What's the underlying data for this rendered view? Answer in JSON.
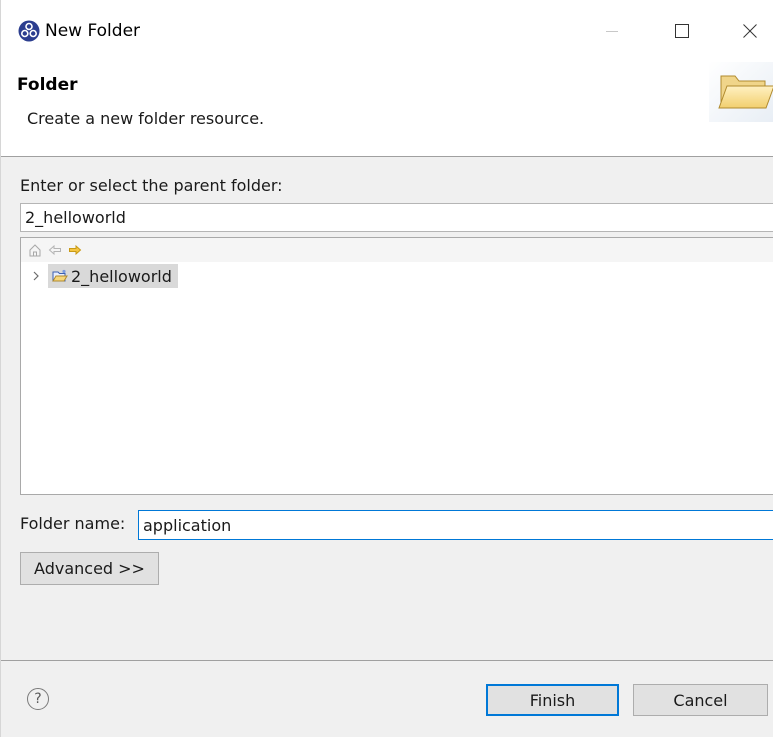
{
  "window": {
    "title": "New Folder",
    "icon": "eclipse-app-icon"
  },
  "banner": {
    "title": "Folder",
    "description": "Create a new folder resource.",
    "image": "folder-wizard-banner-icon"
  },
  "parent_folder": {
    "label": "Enter or select the parent folder:",
    "value": "2_helloworld"
  },
  "tree": {
    "toolbar": [
      "home-icon",
      "back-arrow-icon",
      "forward-arrow-icon"
    ],
    "items": [
      {
        "label": "2_helloworld",
        "icon": "open-project-icon",
        "expanded": false,
        "selected": true
      }
    ]
  },
  "folder_name": {
    "label": "Folder name:",
    "value": "application"
  },
  "buttons": {
    "advanced": "Advanced >>",
    "help": "?",
    "finish": "Finish",
    "cancel": "Cancel"
  },
  "colors": {
    "focus_border": "#0078d7",
    "selection_bg": "#d9d9d9",
    "window_bg": "#f0f0f0"
  }
}
